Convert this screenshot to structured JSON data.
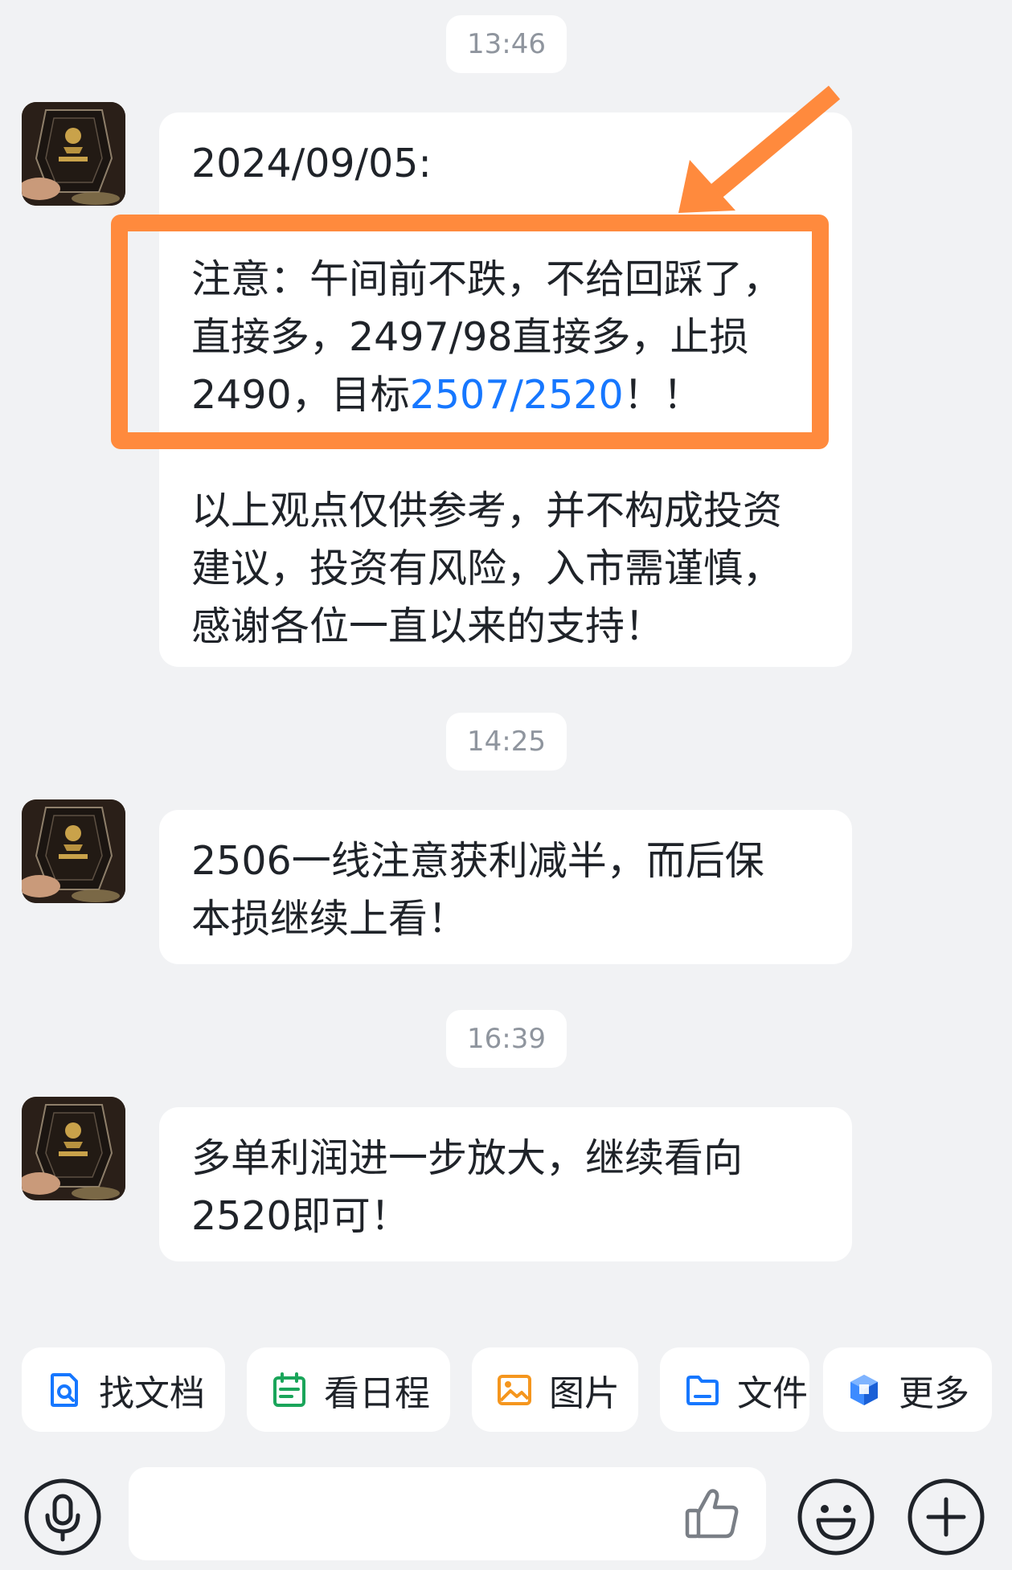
{
  "timestamps": [
    "13:46",
    "14:25",
    "16:39"
  ],
  "messages": [
    {
      "lines": [
        [
          "2024/09/05:"
        ],
        [
          ""
        ],
        [
          "注意：午间前不跌，不给回踩了，"
        ],
        [
          "直接多，2497/98直接多，止损"
        ],
        [
          "2490，目标",
          "2507/2520",
          "！！"
        ],
        [
          ""
        ],
        [
          "以上观点仅供参考，并不构成投资"
        ],
        [
          "建议，投资有风险，入市需谨慎，"
        ],
        [
          "感谢各位一直以来的支持！"
        ]
      ]
    },
    {
      "lines": [
        [
          "2506一线注意获利减半，而后保"
        ],
        [
          "本损继续上看！"
        ]
      ]
    },
    {
      "lines": [
        [
          "多单利润进一步放大，继续看向"
        ],
        [
          "2520即可！"
        ]
      ]
    }
  ],
  "quick_actions": [
    {
      "label": "找文档",
      "icon": "doc-search-icon"
    },
    {
      "label": "看日程",
      "icon": "calendar-icon"
    },
    {
      "label": "图片",
      "icon": "image-icon"
    },
    {
      "label": "文件",
      "icon": "folder-icon"
    },
    {
      "label": "更多",
      "icon": "more-apps-icon"
    }
  ],
  "input": {
    "placeholder": ""
  },
  "colors": {
    "background": "#f1f2f4",
    "bubble": "#ffffff",
    "text": "#1f2329",
    "timestamp_text": "#8f959e",
    "link": "#1677ff",
    "annotation": "#ff8a3d",
    "icon_blue": "#1677ff",
    "icon_green": "#1aa55a",
    "icon_orange": "#f5961e"
  }
}
